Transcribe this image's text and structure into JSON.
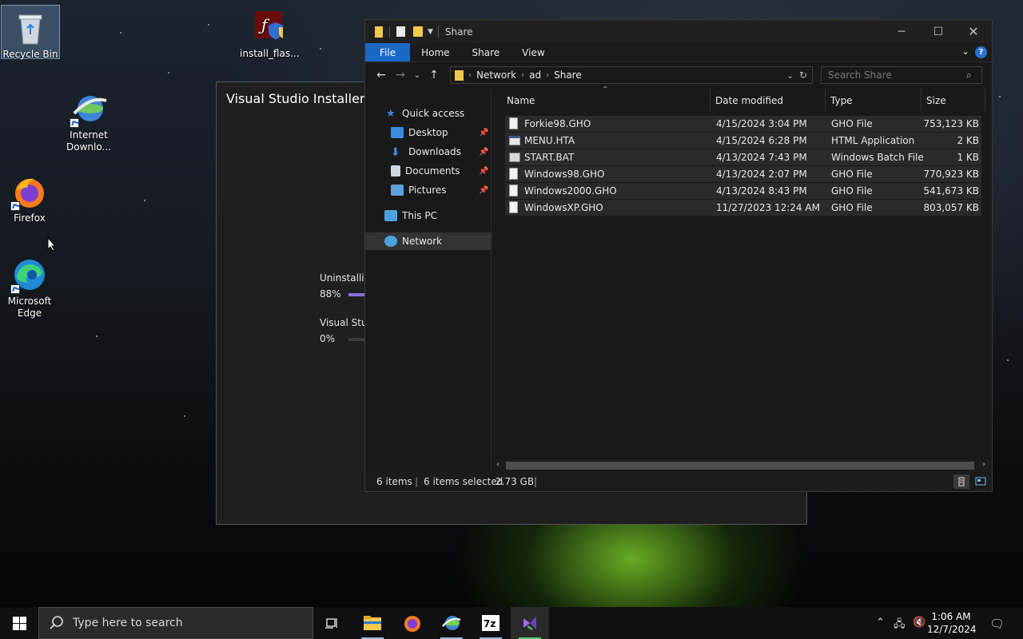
{
  "desktop": {
    "icons": [
      {
        "label": "Recycle Bin"
      },
      {
        "label": "install_flas..."
      },
      {
        "label": "Internet Downlo..."
      },
      {
        "label": "Firefox"
      },
      {
        "label": "Microsoft Edge"
      }
    ]
  },
  "vs_installer": {
    "title": "Visual Studio Installer",
    "row1_label": "Uninstallin",
    "row1_pct": "88%",
    "row1_progress": 0.88,
    "row2_label": "Visual Stud",
    "row2_pct": "0%",
    "row2_progress": 0.0,
    "accent": "#8a6dd8"
  },
  "explorer": {
    "title": "Share",
    "ribbon_tabs": [
      "File",
      "Home",
      "Share",
      "View"
    ],
    "breadcrumb": [
      "Network",
      "ad",
      "Share"
    ],
    "search_placeholder": "Search Share",
    "nav": {
      "quick_access": "Quick access",
      "desktop": "Desktop",
      "downloads": "Downloads",
      "documents": "Documents",
      "pictures": "Pictures",
      "this_pc": "This PC",
      "network": "Network"
    },
    "columns": {
      "name": "Name",
      "date": "Date modified",
      "type": "Type",
      "size": "Size"
    },
    "files": [
      {
        "name": "Forkie98.GHO",
        "date": "4/15/2024 3:04 PM",
        "type": "GHO File",
        "size": "753,123 KB"
      },
      {
        "name": "MENU.HTA",
        "date": "4/15/2024 6:28 PM",
        "type": "HTML Application",
        "size": "2 KB"
      },
      {
        "name": "START.BAT",
        "date": "4/13/2024 7:43 PM",
        "type": "Windows Batch File",
        "size": "1 KB"
      },
      {
        "name": "Windows98.GHO",
        "date": "4/13/2024 2:07 PM",
        "type": "GHO File",
        "size": "770,923 KB"
      },
      {
        "name": "Windows2000.GHO",
        "date": "4/13/2024 8:43 PM",
        "type": "GHO File",
        "size": "541,673 KB"
      },
      {
        "name": "WindowsXP.GHO",
        "date": "11/27/2023 12:24 AM",
        "type": "GHO File",
        "size": "803,057 KB"
      }
    ],
    "status": {
      "items": "6 items",
      "selected": "6 items selected",
      "size": "2.73 GB"
    },
    "accent": "#1a67c4"
  },
  "taskbar": {
    "search_placeholder": "Type here to search",
    "time": "1:06 AM",
    "date": "12/7/2024"
  }
}
